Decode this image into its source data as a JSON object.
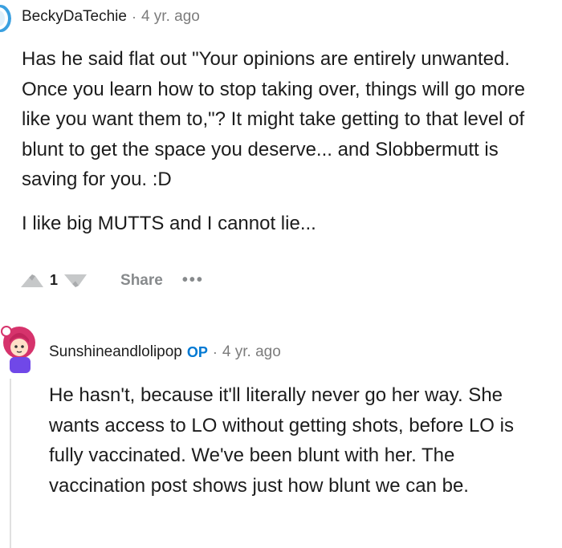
{
  "comments": [
    {
      "username": "BeckyDaTechie",
      "separator": "·",
      "timestamp": "4 yr. ago",
      "paragraphs": [
        "Has he said flat out \"Your opinions are entirely unwanted. Once you learn how to stop taking over, things will go more like you want them to,\"? It might take getting to that level of blunt to get the space you deserve... and Slobbermutt is saving for you. :D",
        "I like big MUTTS and I cannot lie..."
      ],
      "score": "1",
      "share_label": "Share",
      "more_label": "•••"
    },
    {
      "username": "Sunshineandlolipop",
      "op_badge": "OP",
      "separator": "·",
      "timestamp": "4 yr. ago",
      "paragraphs": [
        "He hasn't, because it'll literally never go her way. She wants access to LO without getting shots, before LO is fully vaccinated. We've been blunt with her. The vaccination post shows just how blunt we can be."
      ]
    }
  ],
  "colors": {
    "op_badge": "#0079d3",
    "meta_gray": "#7c7c7c",
    "action_gray": "#878a8c"
  }
}
